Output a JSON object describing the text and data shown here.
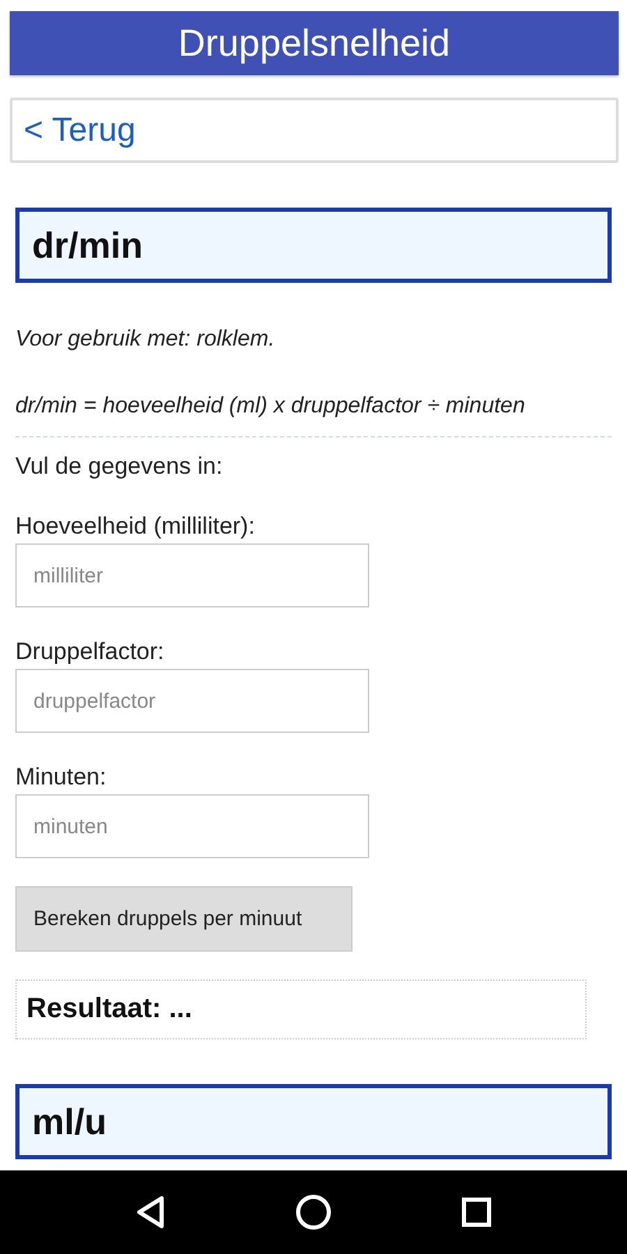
{
  "app_bar": {
    "title": "Druppelsnelheid"
  },
  "back_button": {
    "label": "< Terug"
  },
  "sections": [
    {
      "heading": "dr/min",
      "usage": "Voor gebruik met: rolklem.",
      "formula": "dr/min = hoeveelheid (ml) x druppelfactor ÷ minuten",
      "prompt": "Vul de gegevens in:",
      "fields": [
        {
          "label": "Hoeveelheid (milliliter):",
          "placeholder": "milliliter"
        },
        {
          "label": "Druppelfactor:",
          "placeholder": "druppelfactor"
        },
        {
          "label": "Minuten:",
          "placeholder": "minuten"
        }
      ],
      "button": "Bereken druppels per minuut",
      "result": "Resultaat: ..."
    },
    {
      "heading": "ml/u"
    }
  ]
}
